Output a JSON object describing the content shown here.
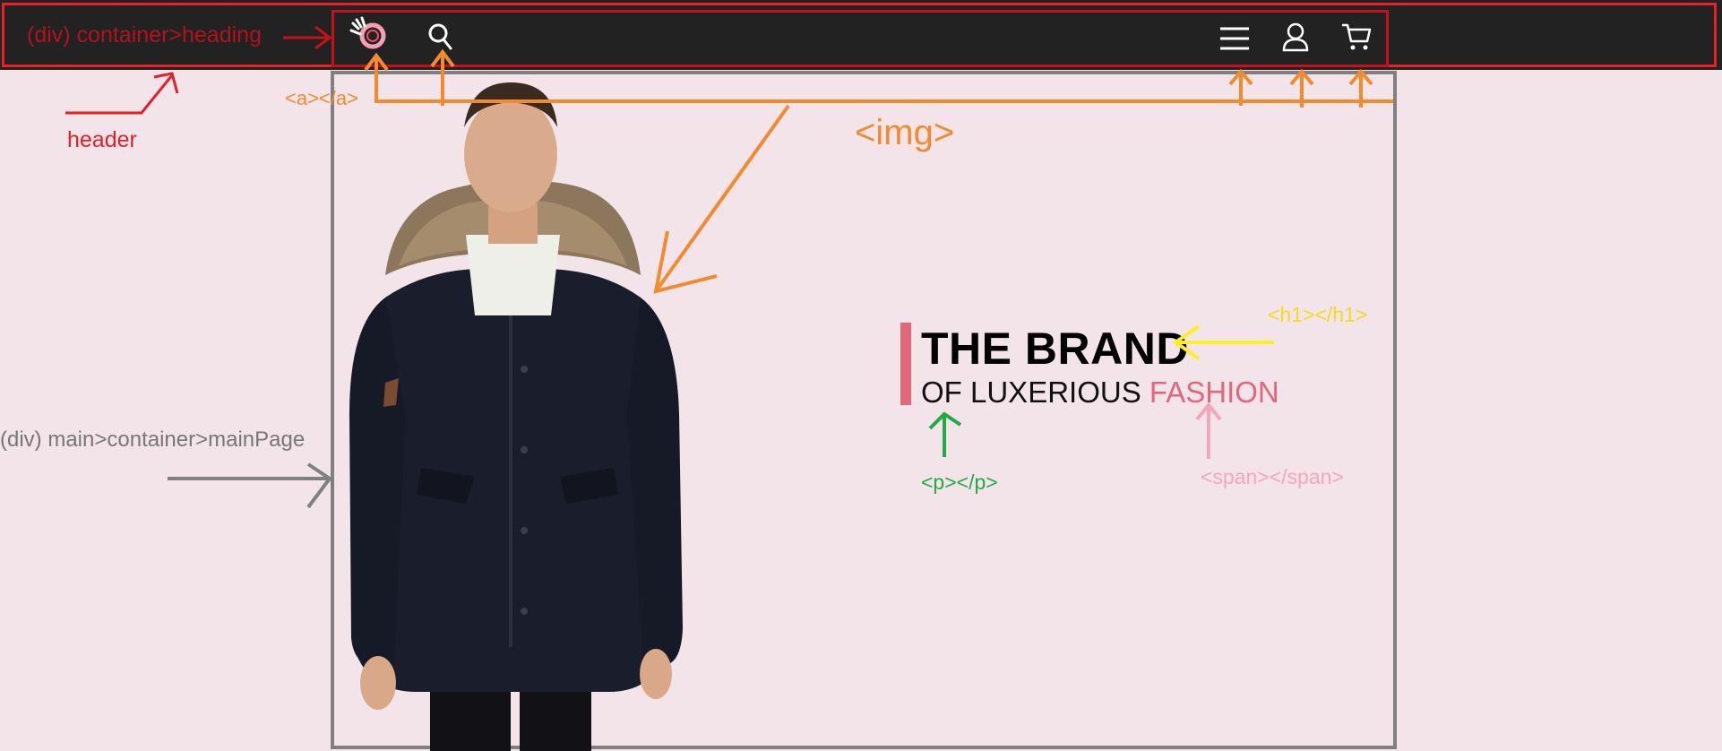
{
  "header": {
    "logo_icon": "hand-circle-logo-icon",
    "icons": [
      "search-icon",
      "hamburger-menu-icon",
      "user-icon",
      "cart-icon"
    ],
    "background": "#222222"
  },
  "hero": {
    "title": "THE BRAND",
    "subtitle_prefix": "OF LUXERIOUS ",
    "subtitle_accent": "FASHION",
    "accent_color": "#e0687a"
  },
  "annotations": {
    "heading_container": "(div) container>heading",
    "header": "header",
    "anchor": "<a></a>",
    "img": "<img>",
    "h1": "<h1></h1>",
    "p": "<p></p>",
    "span": "<span></span>",
    "main_container": "(div) main>container>mainPage"
  },
  "colors": {
    "page_background": "#f2e4e8",
    "header_outline": "#e8202a",
    "heading_outline": "#c4121c",
    "arrow_orange": "#f28a30",
    "arrow_yellow": "#ffee22",
    "arrow_green": "#22aa44",
    "arrow_pink": "#f6a6bc",
    "main_outline": "#808080"
  }
}
